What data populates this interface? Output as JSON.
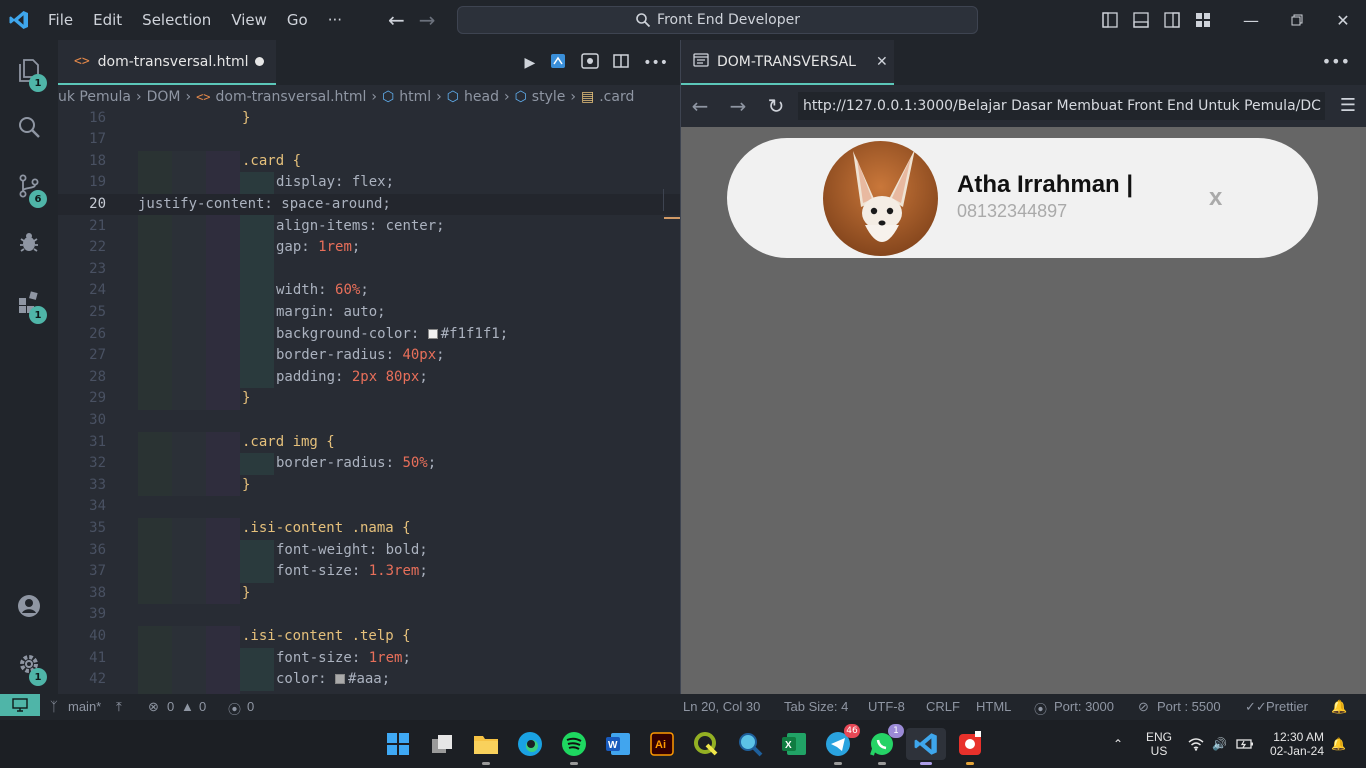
{
  "titlebar": {
    "menu": [
      "File",
      "Edit",
      "Selection",
      "View",
      "Go",
      "···"
    ],
    "search_text": "Front End Developer"
  },
  "activity_badges": {
    "explorer": "1",
    "scm": "6",
    "extensions": "1",
    "settings": "1"
  },
  "editor_tab": {
    "filename": "dom-transversal.html"
  },
  "breadcrumb": [
    "uk Pemula",
    "DOM",
    "dom-transversal.html",
    "html",
    "head",
    "style",
    ".card"
  ],
  "code": {
    "lines": [
      {
        "n": "16",
        "text": "}"
      },
      {
        "n": "17",
        "text": ""
      },
      {
        "n": "18",
        "text": ".card {"
      },
      {
        "n": "19",
        "text": "display: flex;"
      },
      {
        "n": "20",
        "text": "justify-content: space-around;"
      },
      {
        "n": "21",
        "text": "align-items: center;"
      },
      {
        "n": "22",
        "text": "gap: 1rem;"
      },
      {
        "n": "23",
        "text": ""
      },
      {
        "n": "24",
        "text": "width: 60%;"
      },
      {
        "n": "25",
        "text": "margin: auto;"
      },
      {
        "n": "26",
        "text": "background-color: #f1f1f1;"
      },
      {
        "n": "27",
        "text": "border-radius: 40px;"
      },
      {
        "n": "28",
        "text": "padding: 2px 80px;"
      },
      {
        "n": "29",
        "text": "}"
      },
      {
        "n": "30",
        "text": ""
      },
      {
        "n": "31",
        "text": ".card img {"
      },
      {
        "n": "32",
        "text": "border-radius: 50%;"
      },
      {
        "n": "33",
        "text": "}"
      },
      {
        "n": "34",
        "text": ""
      },
      {
        "n": "35",
        "text": ".isi-content .nama {"
      },
      {
        "n": "36",
        "text": "font-weight: bold;"
      },
      {
        "n": "37",
        "text": "font-size: 1.3rem;"
      },
      {
        "n": "38",
        "text": "}"
      },
      {
        "n": "39",
        "text": ""
      },
      {
        "n": "40",
        "text": ".isi-content .telp {"
      },
      {
        "n": "41",
        "text": "font-size: 1rem;"
      },
      {
        "n": "42",
        "text": "color: #aaa;"
      },
      {
        "n": "43",
        "text": "}"
      }
    ]
  },
  "preview": {
    "tab_title": "DOM-TRANSVERSAL",
    "url": "http://127.0.0.1:3000/Belajar Dasar Membuat Front End Untuk Pemula/DC",
    "card_name": "Atha Irrahman |",
    "card_phone": "08132344897",
    "card_close": "x",
    "card_bg": "#f1f1f1"
  },
  "statusbar": {
    "branch": "main*",
    "errors": "0",
    "warnings": "0",
    "ports_count": "0",
    "position": "Ln 20, Col 30",
    "tab_size": "Tab Size: 4",
    "encoding": "UTF-8",
    "eol": "CRLF",
    "language": "HTML",
    "port1": "Port: 3000",
    "port2": "Port : 5500",
    "prettier": "Prettier"
  },
  "taskbar": {
    "lang": "ENG",
    "region": "US",
    "time": "12:30 AM",
    "date": "02-Jan-24",
    "telegram_badge": "46",
    "whatsapp_badge": "1"
  }
}
